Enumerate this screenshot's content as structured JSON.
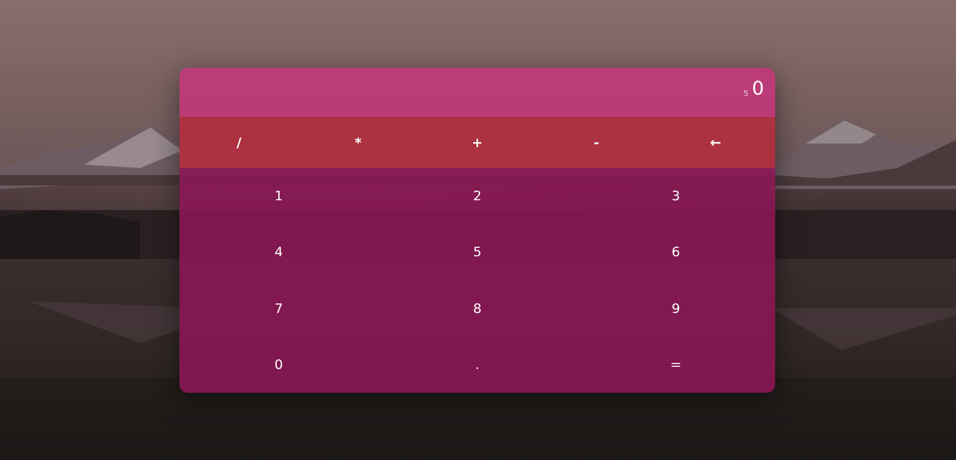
{
  "display": {
    "previous": "5",
    "current": "0"
  },
  "operators": [
    "/",
    "*",
    "+",
    "-",
    "←"
  ],
  "keys": [
    "1",
    "2",
    "3",
    "4",
    "5",
    "6",
    "7",
    "8",
    "9",
    "0",
    ".",
    "="
  ],
  "colors": {
    "display_bg": "#c03878",
    "operators_bg": "#b03040",
    "keys_bg": "#8c1655"
  }
}
